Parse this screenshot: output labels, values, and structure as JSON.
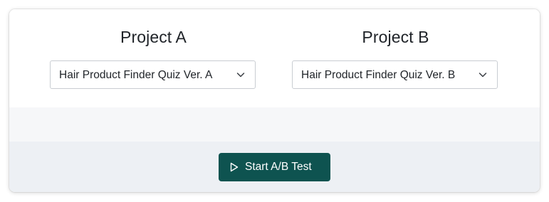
{
  "project_a": {
    "title": "Project A",
    "selected_quiz": "Hair Product Finder Quiz Ver. A"
  },
  "project_b": {
    "title": "Project B",
    "selected_quiz": "Hair Product Finder Quiz Ver. B"
  },
  "actions": {
    "start_label": "Start A/B Test",
    "start_icon": "play-icon"
  },
  "colors": {
    "primary_button": "#0e5350",
    "footer_background": "#edf0f4",
    "band_background": "#f6f7f9"
  }
}
